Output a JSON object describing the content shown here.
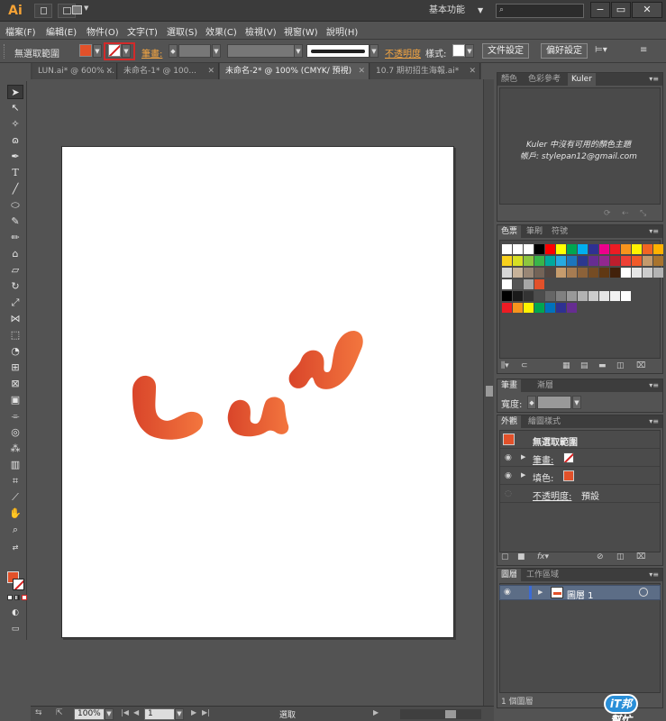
{
  "app": {
    "logo": "Ai",
    "workspace": "基本功能",
    "search_placeholder": ""
  },
  "menu": [
    "檔案(F)",
    "編輯(E)",
    "物件(O)",
    "文字(T)",
    "選取(S)",
    "效果(C)",
    "檢視(V)",
    "視窗(W)",
    "說明(H)"
  ],
  "controlbar": {
    "selection_label": "無選取範圍",
    "stroke_label": "筆畫:",
    "opacity_label": "不透明度",
    "style_label": "樣式:",
    "doc_setup": "文件設定",
    "preferences": "偏好設定",
    "fill_color": "#e2512a"
  },
  "doc_tabs": [
    "LUN.ai* @ 600% ...",
    "未命名-1* @ 100...",
    "未命名-2* @ 100% (CMYK/ 預視)",
    "10.7 期初招生海報.ai*"
  ],
  "artwork": {
    "text": "LUN",
    "gradient_start": "#d9452a",
    "gradient_end": "#f3763e"
  },
  "status": {
    "zoom": "100%",
    "page": "1",
    "mode": "選取"
  },
  "panels": {
    "kuler": {
      "tabs": [
        "顏色",
        "色彩參考",
        "Kuler"
      ],
      "message_line1": "Kuler 中沒有可用的顏色主題",
      "message_line2": "帳戶: stylepan12@gmail.com"
    },
    "swatches": {
      "tabs": [
        "色票",
        "筆刷",
        "符號"
      ]
    },
    "stroke": {
      "tabs": [
        "筆畫",
        "漸層"
      ],
      "width_label": "寬度:"
    },
    "appearance": {
      "tabs": [
        "外觀",
        "繪圖樣式"
      ],
      "title": "無選取範圍",
      "stroke_label": "筆畫:",
      "fill_label": "填色:",
      "opacity_label": "不透明度:",
      "opacity_value": "預設"
    },
    "layers": {
      "tabs": [
        "圖層",
        "工作區域"
      ],
      "layer_name": "圖層 1",
      "footer": "1 個圖層"
    }
  },
  "watermark": "iT邦幫忙"
}
